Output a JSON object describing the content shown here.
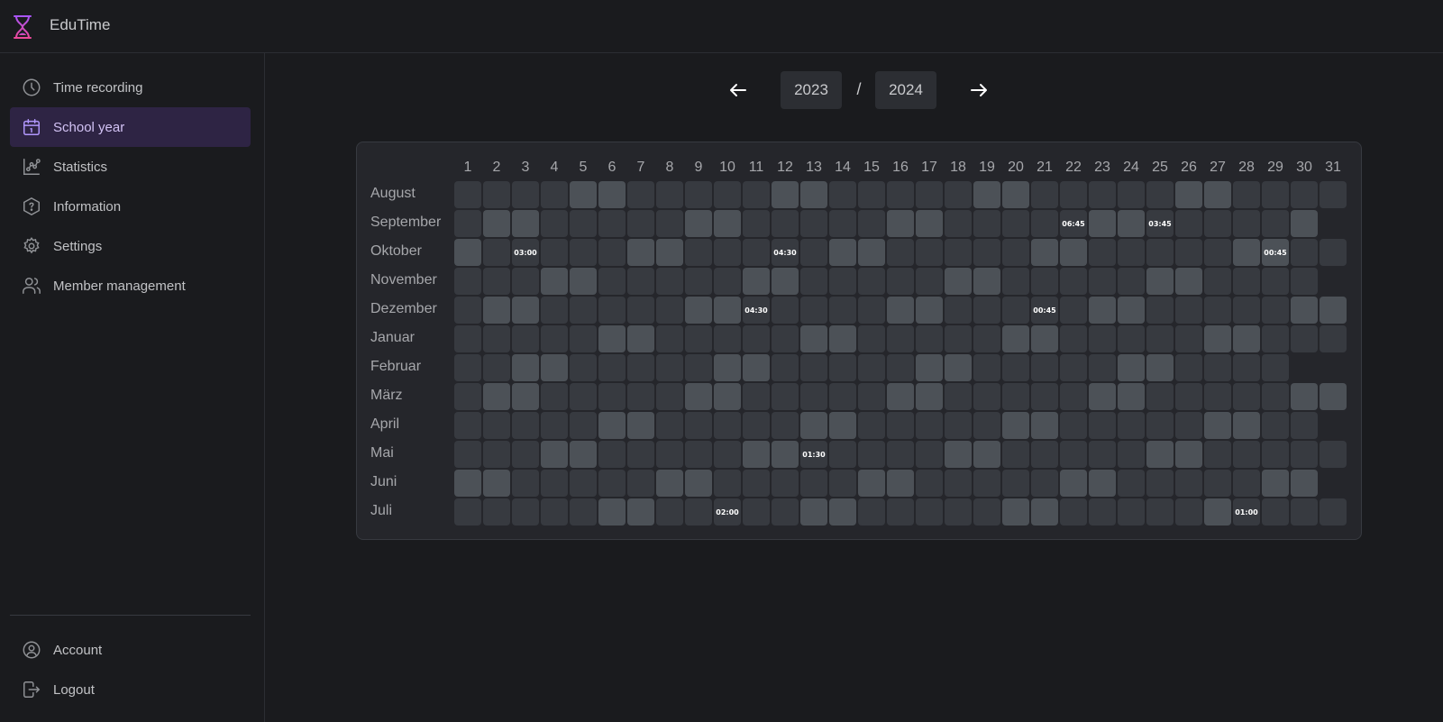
{
  "app": {
    "title": "EduTime",
    "accent": "#9b59d0"
  },
  "sidebar": {
    "items": [
      {
        "label": "Time recording",
        "icon": "clock-icon",
        "active": false
      },
      {
        "label": "School year",
        "icon": "calendar-icon",
        "active": true
      },
      {
        "label": "Statistics",
        "icon": "chart-icon",
        "active": false
      },
      {
        "label": "Information",
        "icon": "help-hexagon-icon",
        "active": false
      },
      {
        "label": "Settings",
        "icon": "gear-icon",
        "active": false
      },
      {
        "label": "Member management",
        "icon": "users-icon",
        "active": false
      }
    ],
    "bottom_items": [
      {
        "label": "Account",
        "icon": "user-circle-icon"
      },
      {
        "label": "Logout",
        "icon": "logout-icon"
      }
    ]
  },
  "year_nav": {
    "start_year": "2023",
    "separator": "/",
    "end_year": "2024"
  },
  "calendar": {
    "days": [
      "1",
      "2",
      "3",
      "4",
      "5",
      "6",
      "7",
      "8",
      "9",
      "10",
      "11",
      "12",
      "13",
      "14",
      "15",
      "16",
      "17",
      "18",
      "19",
      "20",
      "21",
      "22",
      "23",
      "24",
      "25",
      "26",
      "27",
      "28",
      "29",
      "30",
      "31"
    ],
    "months": [
      {
        "name": "August",
        "days_in_month": 31,
        "highlighted": [
          5,
          6,
          12,
          13,
          19,
          20,
          26,
          27
        ],
        "entries": {}
      },
      {
        "name": "September",
        "days_in_month": 30,
        "highlighted": [
          2,
          3,
          9,
          10,
          16,
          17,
          23,
          24,
          30
        ],
        "entries": {
          "22": "06:45",
          "25": "03:45"
        }
      },
      {
        "name": "Oktober",
        "days_in_month": 31,
        "highlighted": [
          1,
          7,
          8,
          14,
          15,
          21,
          22,
          28,
          29
        ],
        "entries": {
          "3": "03:00",
          "12": "04:30",
          "29": "00:45"
        }
      },
      {
        "name": "November",
        "days_in_month": 30,
        "highlighted": [
          4,
          5,
          11,
          12,
          18,
          19,
          25,
          26
        ],
        "entries": {}
      },
      {
        "name": "Dezember",
        "days_in_month": 31,
        "highlighted": [
          2,
          3,
          9,
          10,
          16,
          17,
          23,
          24,
          30,
          31
        ],
        "entries": {
          "11": "04:30",
          "21": "00:45"
        }
      },
      {
        "name": "Januar",
        "days_in_month": 31,
        "highlighted": [
          6,
          7,
          13,
          14,
          20,
          21,
          27,
          28
        ],
        "entries": {}
      },
      {
        "name": "Februar",
        "days_in_month": 29,
        "highlighted": [
          3,
          4,
          10,
          11,
          17,
          18,
          24,
          25
        ],
        "entries": {}
      },
      {
        "name": "März",
        "days_in_month": 31,
        "highlighted": [
          2,
          3,
          9,
          10,
          16,
          17,
          23,
          24,
          30,
          31
        ],
        "entries": {}
      },
      {
        "name": "April",
        "days_in_month": 30,
        "highlighted": [
          6,
          7,
          13,
          14,
          20,
          21,
          27,
          28
        ],
        "entries": {}
      },
      {
        "name": "Mai",
        "days_in_month": 31,
        "highlighted": [
          4,
          5,
          11,
          12,
          18,
          19,
          25,
          26
        ],
        "entries": {
          "13": "01:30"
        }
      },
      {
        "name": "Juni",
        "days_in_month": 30,
        "highlighted": [
          1,
          2,
          8,
          9,
          15,
          16,
          22,
          23,
          29,
          30
        ],
        "entries": {}
      },
      {
        "name": "Juli",
        "days_in_month": 31,
        "highlighted": [
          6,
          7,
          13,
          14,
          20,
          21,
          27
        ],
        "entries": {
          "10": "02:00",
          "28": "01:00"
        }
      }
    ]
  }
}
